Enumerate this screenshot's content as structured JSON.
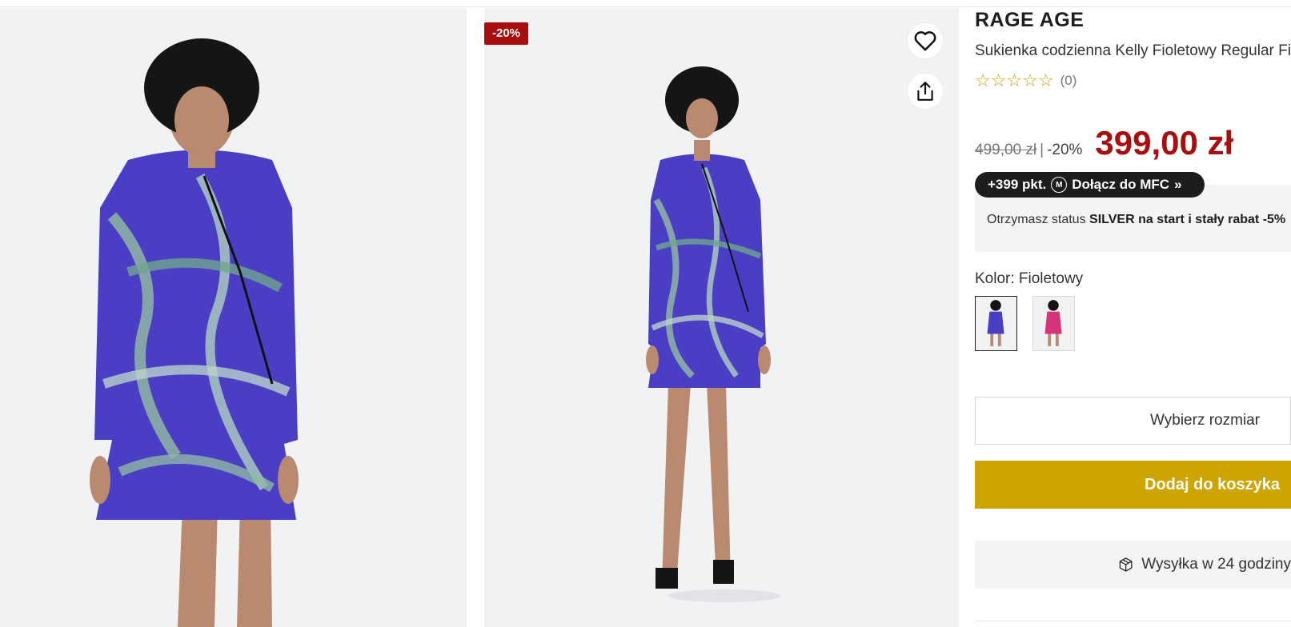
{
  "badge": {
    "discount": "-20%"
  },
  "product": {
    "brand": "RAGE AGE",
    "name": "Sukienka codzienna Kelly Fioletowy Regular Fit",
    "rating_stars": "☆☆☆☆☆",
    "rating_count": "(0)"
  },
  "price": {
    "old": "499,00 zł",
    "separator": "|",
    "discount": "-20%",
    "current": "399,00 zł"
  },
  "mfc": {
    "points": "+399 pkt.",
    "logo_letter": "M",
    "join_label": "Dołącz do MFC",
    "arrow": "»",
    "status_prefix": "Otrzymasz status ",
    "status_bold": "SILVER na start i stały rabat -5%"
  },
  "color": {
    "label": "Kolor: Fioletowy",
    "options": [
      "Fioletowy",
      "Różowy"
    ],
    "selected": "Fioletowy"
  },
  "actions": {
    "size_label": "Wybierz rozmiar",
    "cart_label": "Dodaj do koszyka"
  },
  "shipping": {
    "label": "Wysyłka w 24 godziny"
  },
  "colors": {
    "accent_red": "#a90e0e",
    "cart_gold": "#cfa400",
    "dress_purple": "#4a3fc4",
    "swatch_pink": "#d6337a"
  },
  "icons": [
    "heart-icon",
    "share-icon",
    "star-icon",
    "package-icon"
  ]
}
